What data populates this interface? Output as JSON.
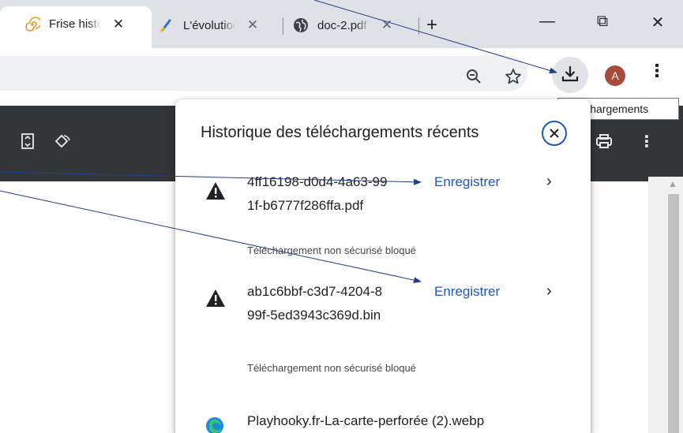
{
  "browser": {
    "tabs": [
      {
        "title": "Frise historique",
        "active": true,
        "icon": "swirl-favicon-icon"
      },
      {
        "title": "L'évolution",
        "active": false,
        "icon": "pen-favicon-icon"
      },
      {
        "title": "doc-2.pdf",
        "active": false,
        "icon": "globe-icon"
      }
    ],
    "new_tab": "+",
    "window_controls": {
      "minimize": "—",
      "restore": "⧉",
      "close": "✕"
    }
  },
  "toolbar": {
    "avatar_letter": "A",
    "download_icon": "download-icon",
    "tooltip": "Téléchargements"
  },
  "downloads_bubble": {
    "title": "Historique des téléchargements récents",
    "items": [
      {
        "filename": "4ff16198-d0d4-4a63-991f-b6777f286ffa.pdf",
        "status": "Téléchargement non sécurisé bloqué",
        "action": "Enregistrer"
      },
      {
        "filename": "ab1c6bbf-c3d7-4204-899f-5ed3943c369d.bin",
        "status": "Téléchargement non sécurisé bloqué",
        "action": "Enregistrer"
      },
      {
        "filename": "Playhooky.fr-La-carte-perforée (2).webp"
      }
    ]
  },
  "colors": {
    "tabstrip": "#dee1e6",
    "accent_blue": "#1a57c4",
    "pdf_toolbar": "#323639",
    "avatar": "#a84a3c",
    "annotation_line": "#1f3f8f"
  }
}
